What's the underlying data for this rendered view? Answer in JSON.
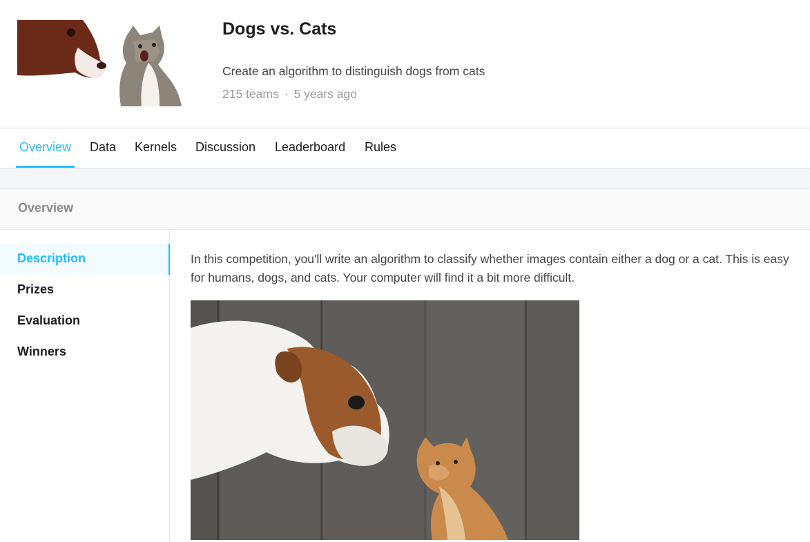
{
  "competition": {
    "title": "Dogs vs. Cats",
    "subtitle": "Create an algorithm to distinguish dogs from cats",
    "teams": "215 teams",
    "separator": "·",
    "age": "5 years ago"
  },
  "tabs": [
    {
      "label": "Overview",
      "active": true
    },
    {
      "label": "Data"
    },
    {
      "label": "Kernels"
    },
    {
      "label": "Discussion"
    },
    {
      "label": "Leaderboard"
    },
    {
      "label": "Rules"
    }
  ],
  "section": {
    "heading": "Overview"
  },
  "sidebar": {
    "items": [
      {
        "label": "Description",
        "active": true
      },
      {
        "label": "Prizes"
      },
      {
        "label": "Evaluation"
      },
      {
        "label": "Winners"
      }
    ]
  },
  "content": {
    "description": "In this competition, you'll write an algorithm to classify whether images contain either a dog or a cat.  This is easy for humans, dogs, and cats. Your computer will find it a bit more difficult."
  },
  "colors": {
    "accent": "#20beff",
    "text": "#1c1c1c",
    "muted": "#9a9a9a"
  }
}
